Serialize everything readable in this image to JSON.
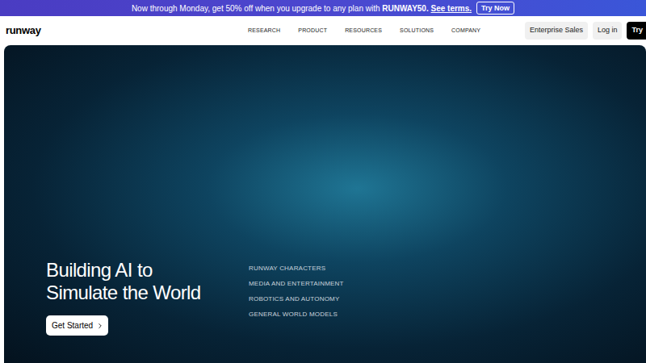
{
  "banner": {
    "text": "Now through Monday, get 50% off when you upgrade to any plan with",
    "code": "RUNWAY50.",
    "link": "See terms.",
    "button": "Try Now"
  },
  "nav": {
    "logo": "runway",
    "links": [
      "RESEARCH",
      "PRODUCT",
      "RESOURCES",
      "SOLUTIONS",
      "COMPANY"
    ],
    "actions": [
      {
        "label": "Enterprise Sales",
        "kind": "secondary"
      },
      {
        "label": "Log in",
        "kind": "secondary"
      },
      {
        "label": "Try",
        "kind": "primary"
      }
    ]
  },
  "hero": {
    "title_lines": [
      "Building AI to",
      "Simulate the World"
    ],
    "button": "Get Started",
    "links": [
      "RUNWAY CHARACTERS",
      "MEDIA AND ENTERTAINMENT",
      "ROBOTICS AND AUTONOMY",
      "GENERAL WORLD MODELS"
    ]
  }
}
